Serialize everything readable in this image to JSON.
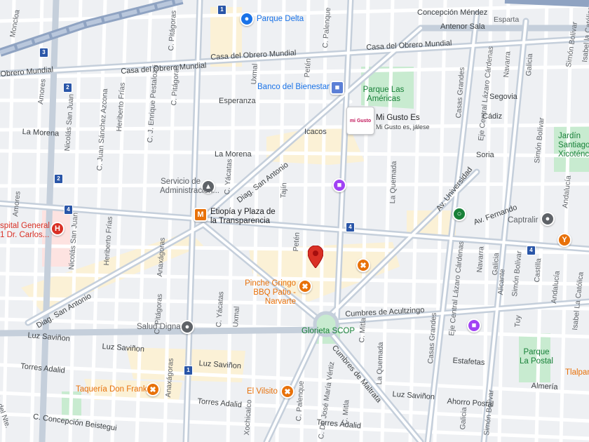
{
  "streets": {
    "concepcion_mendez": "Concepción Méndez",
    "esparta": "Esparta",
    "antenor_sala": "Antenor Sala",
    "simon_bolivar_top": "Simón Bolívar",
    "obrero_mundial_1": "Casa del Obrero Mundial",
    "obrero_mundial_2": "Casa del Obrero Mundial",
    "obrero_mundial_3": "Casa del Obrero Mundial",
    "obrero_mundial_left": "Obrero Mundial",
    "moncloa": "Moncloa",
    "amores": "Amores",
    "amores_2": "Amores",
    "nicolas_san_juan": "Nicolás San Juan",
    "nicolas_san_juan_2": "Nicolás San Juan",
    "juan_sanchez_azcona": "C. Juan Sánchez Azcona",
    "heriberto_frias": "Heriberto Frías",
    "heriberto_frias_2": "Heriberto Frías",
    "enrique_pestalozzi": "C. J. Enrique Pestalozzi",
    "pitagoras_1": "C. Pitágoras",
    "pitagoras_2": "C. Pitágoras",
    "pitagoras_3": "C. Pitágoras",
    "pitagoras_4": "C. Pitágoras",
    "uxmal_top": "Uxmal",
    "uxmal_bottom": "Uxmal",
    "peten_top": "Petén",
    "peten_mid": "Petén",
    "palenque_top": "C. Palenque",
    "palenque_bottom": "C. Palenque",
    "esperanza": "Esperanza",
    "la_morena_left": "La Morena",
    "la_morena_mid": "La Morena",
    "icacos": "Icacos",
    "soria": "Soria",
    "yacatas_1": "C. Yácatas",
    "yacatas_2": "C. Yácatas",
    "tajin": "Tajín",
    "diag_san_antonio_1": "Diag. San Antonio",
    "diag_san_antonio_2": "Diag. San Antonio",
    "la_quemada_1": "La Quemada",
    "la_quemada_2": "La Quemada",
    "av_universidad": "Av. Universidad",
    "av_fernando": "Av. Fernando",
    "eje_central_1": "Eje Central Lázaro Cárdenas",
    "eje_central_2": "Eje Central Lázaro Cárdenas",
    "casas_grandes_1": "Casas Grandes",
    "casas_grandes_2": "Casas Grandes",
    "navarra_1": "Navarra",
    "navarra_2": "Navarra",
    "galicia_1": "Galicia",
    "galicia_2": "Galicia",
    "galicia_3": "Galicia",
    "simon_bolivar_1": "Simón Bolívar",
    "simon_bolivar_2": "Simón Bolívar",
    "simon_bolivar_3": "Simón Bolívar",
    "segovia": "Segovia",
    "cadiz": "Cádiz",
    "andalucia_1": "Andalucía",
    "andalucia_2": "Andalucía",
    "isabel_catolica_1": "Isabel La Católica",
    "isabel_catolica_2": "Isabel la Católica",
    "alicante": "Alicante",
    "castilla": "Castilla",
    "tuy": "Tuy",
    "anaxagoras_1": "Anaxágoras",
    "anaxagoras_2": "Anaxágoras",
    "cumbres_acultzingo": "Cumbres de Acultzingo",
    "cumbres_maltrata": "Cumbres de Maltrata",
    "luz_savinon_1": "Luz Saviñon",
    "luz_savinon_2": "Luz Saviñon",
    "luz_savinon_3": "Luz Saviñon",
    "luz_savinon_4": "Luz Saviñon",
    "torres_adalid_1": "Torres Adalid",
    "torres_adalid_2": "Torres Adalid",
    "torres_adalid_3": "Torres Adalid",
    "mitla_1": "C. Mitla",
    "mitla_2": "C. Mitla",
    "jose_maria_vertiz": "C. Dr. José María Vértiz",
    "xochicalco": "Xochicalco",
    "estafetas": "Estafetas",
    "ahorro_postal": "Ahorro Postal",
    "almeria": "Almería",
    "concepcion_beistegui": "C. Concepción Beistegui",
    "division_nte": "ón del Nte."
  },
  "places": {
    "parque_delta": "Parque Delta",
    "banco_bienestar": "Banco del Bienestar",
    "parque_americas": "Parque Las Américas",
    "mi_gusto_title": "Mi Gusto Es",
    "mi_gusto_sub": "Mi Gusto es, jálese",
    "mi_gusto_card": "mi Gusto",
    "servicio_admin": "Servicio de Administración...",
    "etiopia": "Etiopía y Plaza de la Transparencia",
    "hospital": "spital General 1 Dr. Carlos...",
    "pinche_gringo": "Pinche Gringo BBQ Patio - Narvarte",
    "glorieta": "Glorieta SCOP",
    "salud_digna": "Salud Digna",
    "taqueria": "Taquería Don Frank",
    "el_vilsito": "El Vilsito",
    "captralir": "Captralir",
    "parque_postal": "Parque La Postal",
    "jardin": "Jardín Santiago Xicoténcatl",
    "tlalpan": "Tlalpan"
  },
  "route_shields": {
    "r1_top": "1",
    "r1_bottom": "1",
    "r2_a": "2",
    "r2_b": "2",
    "r3": "3",
    "r4_left": "4",
    "r4_mid": "4",
    "r4_right": "4"
  },
  "icons": {
    "parque_delta": "shopping-bag-icon",
    "banco": "bank-icon",
    "servicio": "government-building-icon",
    "metro": "metro-station-icon",
    "hospital": "hospital-icon",
    "restaurant": "fork-knife-icon",
    "salud": "medical-icon",
    "captralir": "service-icon",
    "bar": "cocktail-icon",
    "shopping": "shopping-icon",
    "green_poi": "circle-poi-icon",
    "location_pin": "red-location-pin-icon"
  },
  "colors": {
    "road": "#ffffff",
    "arterial": "#c5cfdb",
    "park": "#c8ebd0",
    "commercial": "#fbf1d6",
    "route_shield": "#2a56a8",
    "pin": "#d93025",
    "restaurant": "#e8710a",
    "shopping": "#a142f4"
  }
}
